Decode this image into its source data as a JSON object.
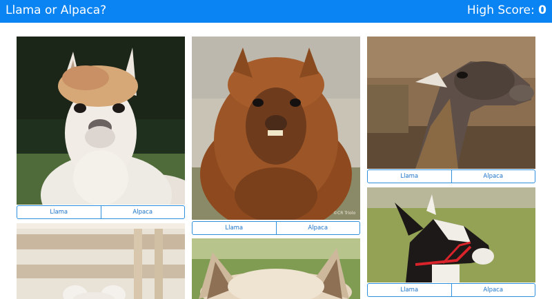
{
  "header": {
    "title": "Llama or Alpaca?",
    "score_label": "High Score:",
    "score_value": "0"
  },
  "cards": [
    {
      "llama_label": "Llama",
      "alpaca_label": "Alpaca"
    },
    {
      "llama_label": "Llama",
      "alpaca_label": "Alpaca"
    },
    {
      "llama_label": "Llama",
      "alpaca_label": "Alpaca"
    },
    {
      "llama_label": "Llama",
      "alpaca_label": "Alpaca"
    }
  ],
  "photo_watermark": "©CR Triolo"
}
